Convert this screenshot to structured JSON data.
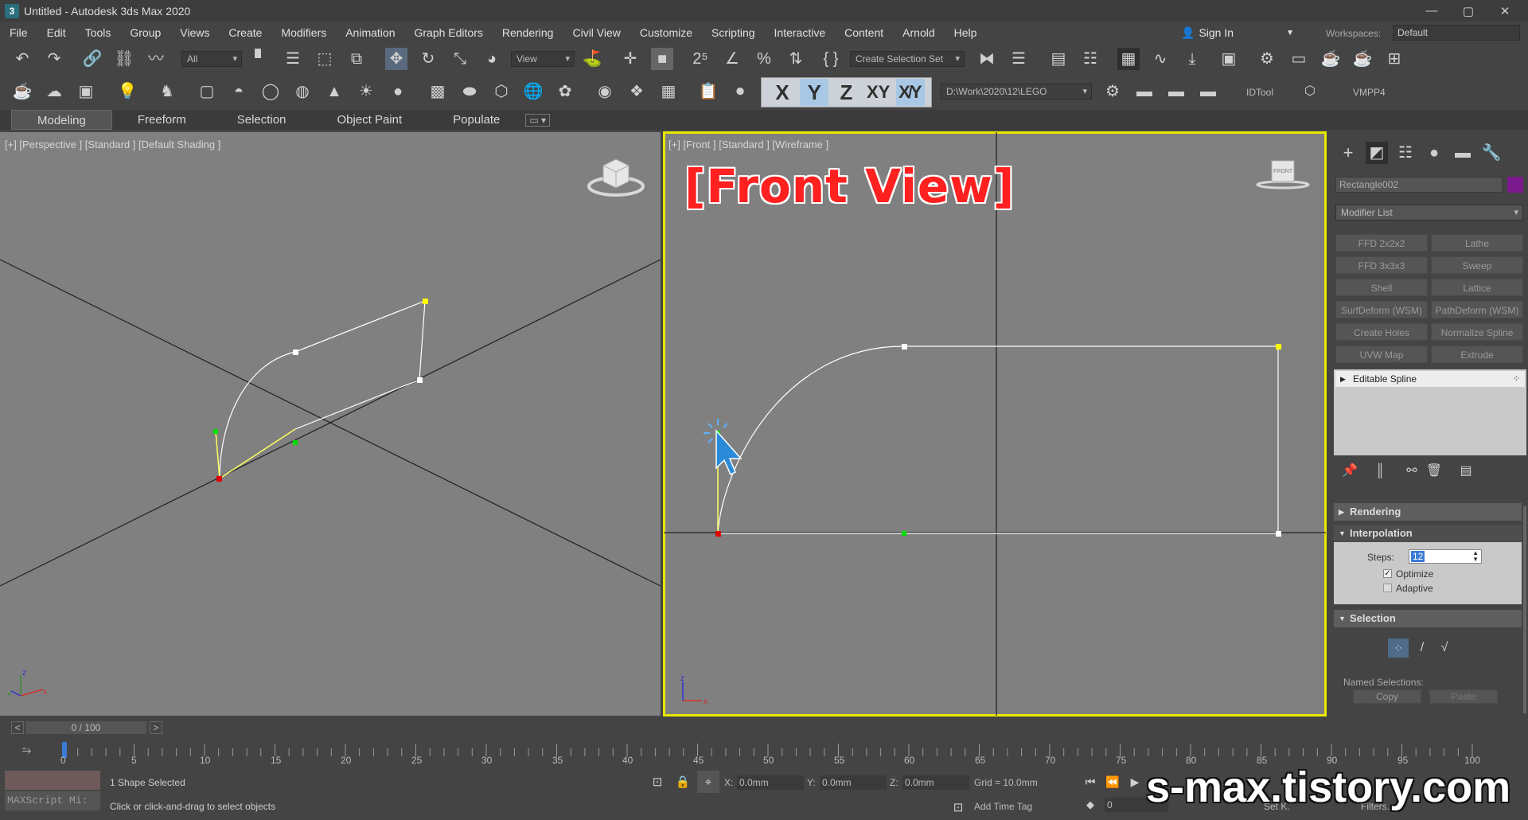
{
  "window": {
    "title": "Untitled - Autodesk 3ds Max 2020",
    "min": "—",
    "max": "▢",
    "close": "✕"
  },
  "menu": [
    "File",
    "Edit",
    "Tools",
    "Group",
    "Views",
    "Create",
    "Modifiers",
    "Animation",
    "Graph Editors",
    "Rendering",
    "Civil View",
    "Customize",
    "Scripting",
    "Interactive",
    "Content",
    "Arnold",
    "Help"
  ],
  "account": {
    "sign_in": "Sign In",
    "workspaces_label": "Workspaces:",
    "workspace": "Default"
  },
  "toolbar": {
    "filter": "All",
    "ref_coord": "View",
    "selection_set": "Create Selection Set",
    "path": "D:\\Work\\2020\\12\\LEGO",
    "idtool": "IDTool",
    "vmpp": "VMPP4"
  },
  "axis_constraints": {
    "x": "X",
    "y": "Y",
    "z": "Z",
    "xy": "XY",
    "xy2": "X̸Y",
    "active": "Y"
  },
  "ribbon": {
    "tabs": [
      "Modeling",
      "Freeform",
      "Selection",
      "Object Paint",
      "Populate"
    ],
    "active": "Modeling"
  },
  "viewports": {
    "left": {
      "label": "[+] [Perspective ] [Standard ] [Default Shading ]"
    },
    "right": {
      "label": "[+] [Front ] [Standard ] [Wireframe ]",
      "overlay_title": "[Front View]",
      "cube_label": "FRONT"
    }
  },
  "command_panel": {
    "object_name": "Rectangle002",
    "object_color": "#7a1a8c",
    "modifier_list": "Modifier List",
    "modifier_buttons": [
      "FFD 2x2x2",
      "Lathe",
      "FFD 3x3x3",
      "Sweep",
      "Shell",
      "Lattice",
      "SurfDeform (WSM)",
      "PathDeform (WSM)",
      "Create Holes",
      "Normalize Spline",
      "UVW Map",
      "Extrude"
    ],
    "stack": [
      "Editable Spline"
    ],
    "rollouts": {
      "rendering": "Rendering",
      "interpolation": "Interpolation",
      "steps_label": "Steps:",
      "steps_value": "12",
      "optimize": "Optimize",
      "optimize_checked": true,
      "adaptive": "Adaptive",
      "adaptive_checked": false,
      "selection": "Selection",
      "named_selections": "Named Selections:",
      "copy": "Copy",
      "paste": "Paste"
    }
  },
  "timeline": {
    "frame_display": "0 / 100",
    "ticks": [
      "0",
      "5",
      "10",
      "15",
      "20",
      "25",
      "30",
      "35",
      "40",
      "45",
      "50",
      "55",
      "60",
      "65",
      "70",
      "75",
      "80",
      "85",
      "90",
      "95",
      "100"
    ]
  },
  "status": {
    "maxscript": "MAXScript Mi:",
    "selected": "1 Shape Selected",
    "prompt": "Click or click-and-drag to select objects",
    "x_label": "X:",
    "x": "0.0mm",
    "y_label": "Y:",
    "y": "0.0mm",
    "z_label": "Z:",
    "z": "0.0mm",
    "grid": "Grid = 10.0mm",
    "add_time_tag": "Add Time Tag",
    "frame": "0",
    "set_key": "Set K.",
    "filters": "Filters..."
  },
  "watermark": "s-max.tistory.com"
}
